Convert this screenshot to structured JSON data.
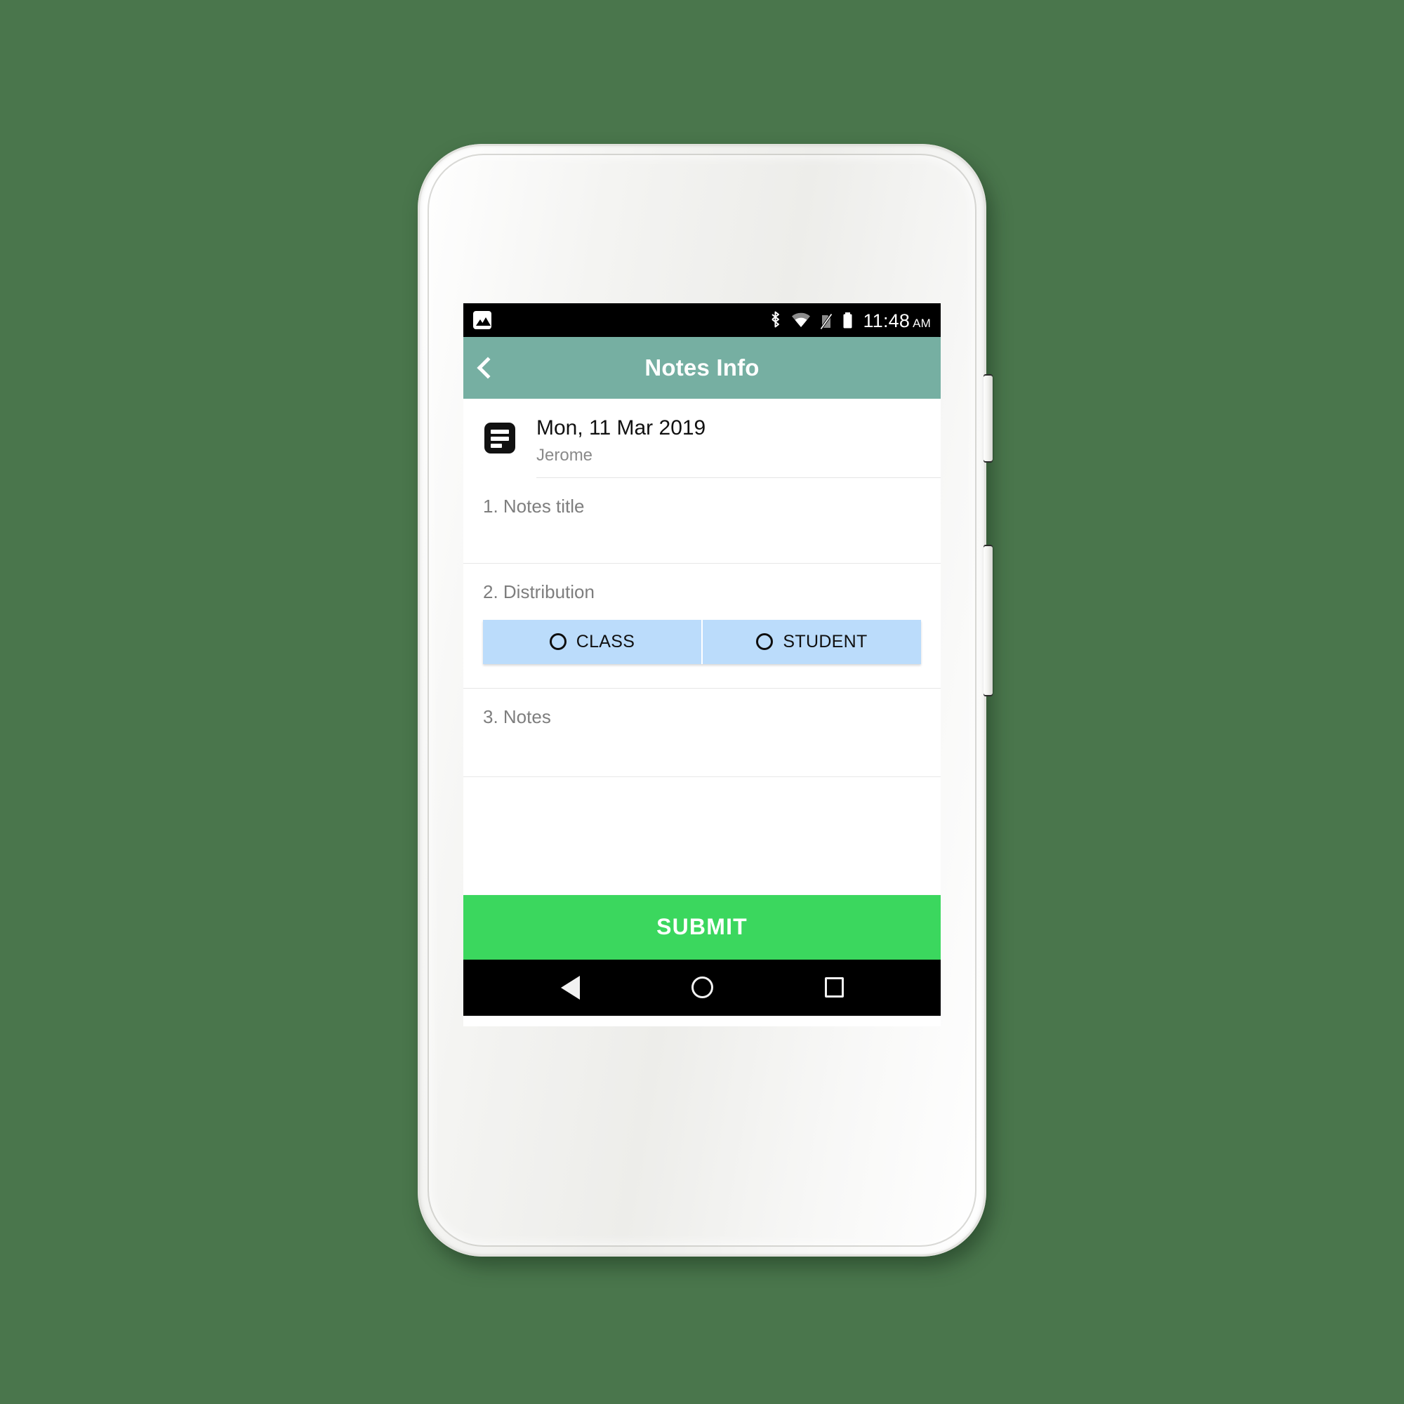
{
  "theme": {
    "page_background": "#4a764c",
    "app_bar_color": "#76afa2",
    "segment_color": "#bbdcfb",
    "submit_color": "#3bd75e",
    "status_bar_color": "#000000"
  },
  "status_bar": {
    "notification_icon": "image-icon",
    "icons": [
      "bluetooth-icon",
      "wifi-icon",
      "no-sim-icon",
      "battery-icon"
    ],
    "time": "11:48",
    "meridiem": "AM"
  },
  "app_bar": {
    "back_icon": "chevron-left-icon",
    "title": "Notes Info"
  },
  "record_header": {
    "icon": "notes-icon",
    "date": "Mon, 11 Mar 2019",
    "author": "Jerome"
  },
  "form": {
    "fields": [
      {
        "label": "1. Notes title",
        "type": "text",
        "value": "",
        "placeholder": ""
      },
      {
        "label": "2. Distribution",
        "type": "radio-group",
        "options": [
          {
            "label": "CLASS",
            "selected": false
          },
          {
            "label": "STUDENT",
            "selected": false
          }
        ]
      },
      {
        "label": "3. Notes",
        "type": "text",
        "value": "",
        "placeholder": ""
      }
    ]
  },
  "submit": {
    "label": "SUBMIT"
  },
  "nav_bar": {
    "back": "nav-back-icon",
    "home": "nav-home-icon",
    "recents": "nav-recents-icon"
  }
}
